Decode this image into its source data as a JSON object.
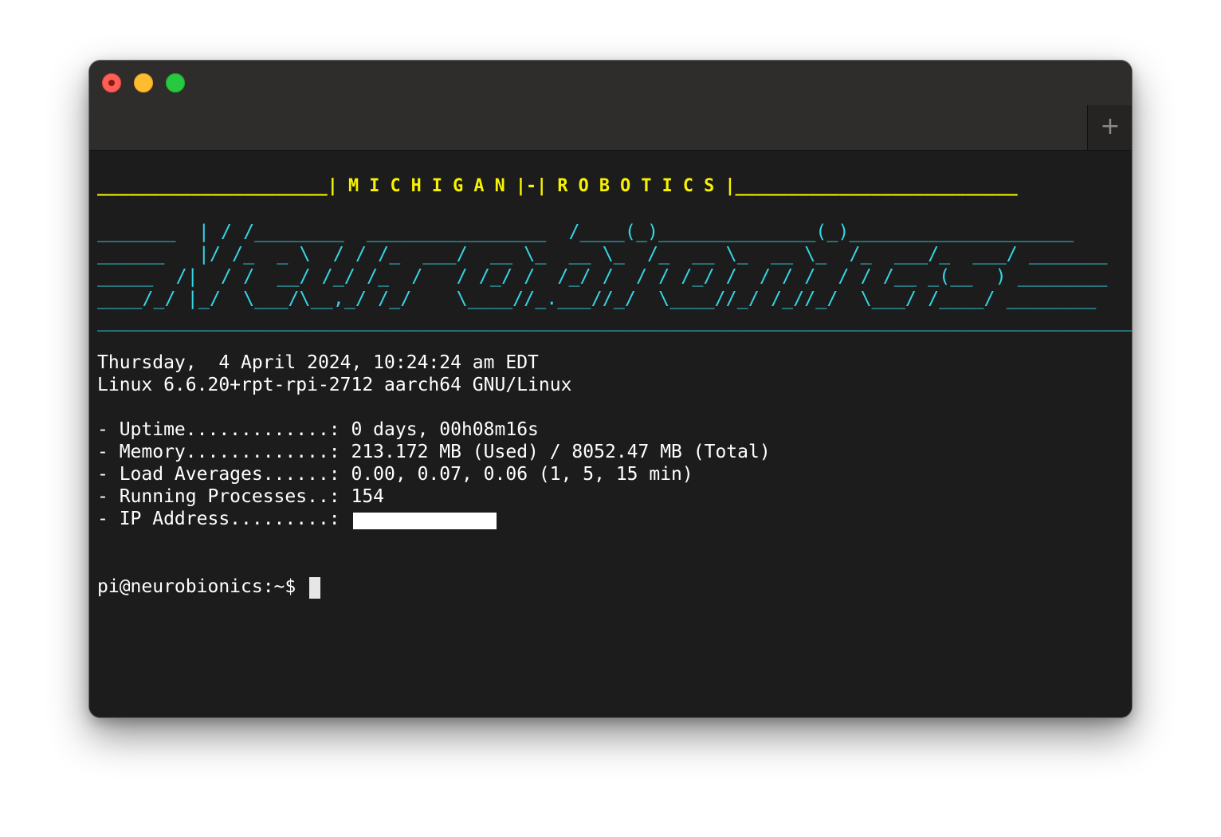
{
  "window": {
    "controls": {
      "close_icon": "traffic-light-close",
      "minimize_icon": "traffic-light-minimize",
      "zoom_icon": "traffic-light-zoom"
    },
    "new_tab_label": "+"
  },
  "colors": {
    "background": "#1c1c1c",
    "titlebar": "#2e2d2c",
    "banner_yellow": "#f7f300",
    "ascii_cyan": "#34d6e6",
    "text": "#ffffff"
  },
  "terminal": {
    "banner": "______________________| M I C H I G A N |-| R O B O T I C S |___________________________",
    "ascii_art": [
      "_______  | / /________  ________________  /____(_)______________(_)____________________",
      "______   |/ /_  _ \\  / / /_  ___/  __ \\_  __ \\_  /_  __ \\_  __ \\_  /_  ___/_  ___/ _______",
      "_____  /|  / /  __/ /_/ /_  /   / /_/ /  /_/ /  / / /_/ /  / / /  / / /__ _(__  ) ________",
      "____/_/ |_/  \\___/\\__,_/ /_/    \\____//_.___//_/  \\____//_/ /_//_/  \\___/ /____/ ________",
      "_____________________________________________________________________________________________"
    ],
    "datetime": "Thursday,  4 April 2024, 10:24:24 am EDT",
    "kernel": "Linux 6.6.20+rpt-rpi-2712 aarch64 GNU/Linux",
    "stats": [
      "- Uptime.............: 0 days, 00h08m16s",
      "- Memory.............: 213.172 MB (Used) / 8052.47 MB (Total)",
      "- Load Averages......: 0.00, 0.07, 0.06 (1, 5, 15 min)",
      "- Running Processes..: 154",
      "- IP Address.........: "
    ],
    "prompt": "pi@neurobionics:~$ "
  }
}
